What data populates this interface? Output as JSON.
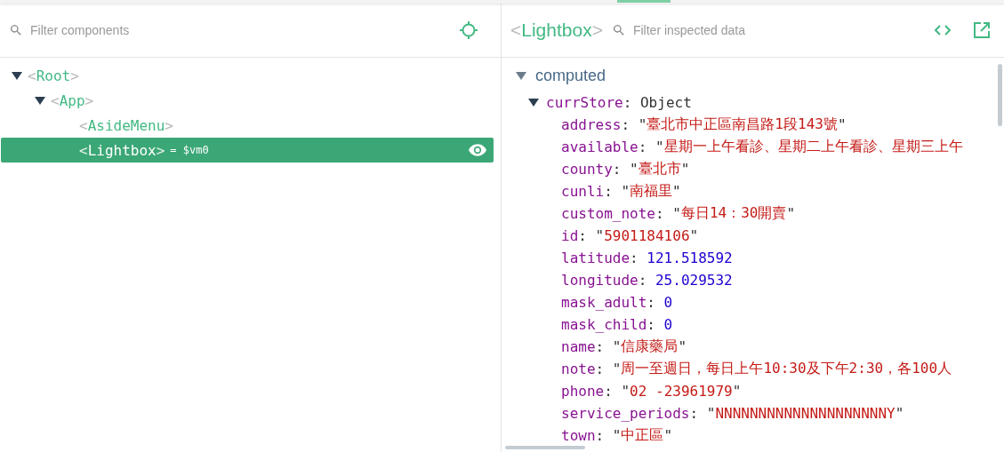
{
  "brackets": [
    "<",
    ">"
  ],
  "separator": ":",
  "components_panel": {
    "search": {
      "placeholder": "Filter components"
    },
    "tree": [
      {
        "name": "Root",
        "expanded": true,
        "selected": false,
        "children": [
          {
            "name": "App",
            "expanded": true,
            "selected": false,
            "children": [
              {
                "name": "AsideMenu",
                "selected": false
              },
              {
                "name": "Lightbox",
                "selected": true,
                "ref": "= $vm0"
              }
            ]
          }
        ]
      }
    ]
  },
  "inspector": {
    "title": "Lightbox",
    "search": {
      "placeholder": "Filter inspected data"
    },
    "section": {
      "label": "computed",
      "expanded": true
    },
    "object": {
      "key": "currStore",
      "type": "Object",
      "expanded": true
    },
    "fields": [
      {
        "key": "address",
        "kind": "string",
        "value": "\"臺北市中正區南昌路1段143號\""
      },
      {
        "key": "available",
        "kind": "string",
        "value": "\"星期一上午看診、星期二上午看診、星期三上午"
      },
      {
        "key": "county",
        "kind": "string",
        "value": "\"臺北市\""
      },
      {
        "key": "cunli",
        "kind": "string",
        "value": "\"南福里\""
      },
      {
        "key": "custom_note",
        "kind": "string",
        "value": "\"每日14：30開賣\""
      },
      {
        "key": "id",
        "kind": "string",
        "value": "\"5901184106\""
      },
      {
        "key": "latitude",
        "kind": "number",
        "value": "121.518592"
      },
      {
        "key": "longitude",
        "kind": "number",
        "value": "25.029532"
      },
      {
        "key": "mask_adult",
        "kind": "number",
        "value": "0"
      },
      {
        "key": "mask_child",
        "kind": "number",
        "value": "0"
      },
      {
        "key": "name",
        "kind": "string",
        "value": "\"信康藥局\""
      },
      {
        "key": "note",
        "kind": "string",
        "value": "\"周一至週日，每日上午10:30及下午2:30，各100人"
      },
      {
        "key": "phone",
        "kind": "string",
        "value": "\"02 -23961979\""
      },
      {
        "key": "service_periods",
        "kind": "string",
        "value": "\"NNNNNNNNNNNNNNNNNNNNY\""
      },
      {
        "key": "town",
        "kind": "string",
        "value": "\"中正區\""
      }
    ]
  }
}
